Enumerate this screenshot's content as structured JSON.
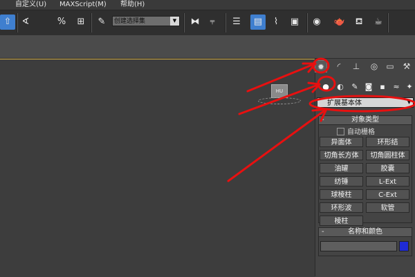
{
  "menu": {
    "items": [
      "自定义(U)",
      "MAXScript(M)",
      "帮助(H)"
    ]
  },
  "toolbar": {
    "selection_set_value": "创建选择集",
    "tools": [
      {
        "icon": "arrow-select-icon",
        "glyph": "⇧",
        "active": true
      },
      {
        "icon": "angle-snap-icon",
        "glyph": "∢"
      },
      {
        "icon": "percent-snap-icon",
        "glyph": "%"
      },
      {
        "icon": "spinner-snap-icon",
        "glyph": "⊞"
      },
      {
        "icon": "edit-named-selection-icon",
        "glyph": "✎"
      },
      {
        "icon": "mirror-icon",
        "glyph": "⧓"
      },
      {
        "icon": "align-icon",
        "glyph": "⫧"
      },
      {
        "icon": "layer-manager-icon",
        "glyph": "☰"
      },
      {
        "icon": "scene-explorer-icon",
        "glyph": "▤",
        "active": true
      },
      {
        "icon": "curve-editor-icon",
        "glyph": "⌇"
      },
      {
        "icon": "schematic-view-icon",
        "glyph": "▣"
      },
      {
        "icon": "material-editor-icon",
        "glyph": "◉"
      },
      {
        "icon": "render-setup-icon",
        "glyph": "🫖"
      },
      {
        "icon": "rendered-frame-icon",
        "glyph": "⛾"
      },
      {
        "icon": "render-icon",
        "glyph": "☕"
      }
    ]
  },
  "command_panel": {
    "tabs": [
      {
        "icon": "create-tab-icon",
        "glyph": "✹",
        "active": true
      },
      {
        "icon": "modify-tab-icon",
        "glyph": "◜"
      },
      {
        "icon": "hierarchy-tab-icon",
        "glyph": "⊥"
      },
      {
        "icon": "motion-tab-icon",
        "glyph": "◎"
      },
      {
        "icon": "display-tab-icon",
        "glyph": "▭"
      },
      {
        "icon": "utilities-tab-icon",
        "glyph": "⚒"
      }
    ],
    "create_categories": [
      {
        "icon": "geometry-icon",
        "glyph": "●",
        "active": true
      },
      {
        "icon": "shapes-icon",
        "glyph": "◐"
      },
      {
        "icon": "lights-icon",
        "glyph": "✎"
      },
      {
        "icon": "cameras-icon",
        "glyph": "◙"
      },
      {
        "icon": "helpers-icon",
        "glyph": "▪"
      },
      {
        "icon": "spacewarps-icon",
        "glyph": "≈"
      },
      {
        "icon": "systems-icon",
        "glyph": "✦"
      }
    ],
    "category_select": "扩展基本体",
    "object_type": {
      "title": "对象类型",
      "autogrid_label": "自动栅格",
      "buttons": [
        "异面体",
        "环形结",
        "切角长方体",
        "切角圆柱体",
        "油罐",
        "胶囊",
        "纺锤",
        "L-Ext",
        "球棱柱",
        "C-Ext",
        "环形波",
        "软管",
        "棱柱"
      ]
    },
    "name_color": {
      "title": "名称和颜色",
      "name_value": "",
      "color": "#1f2bd6"
    }
  },
  "viewport": {
    "object_label": "HU",
    "border_color": "#d8b24a"
  },
  "annotation_color": "#e81010"
}
